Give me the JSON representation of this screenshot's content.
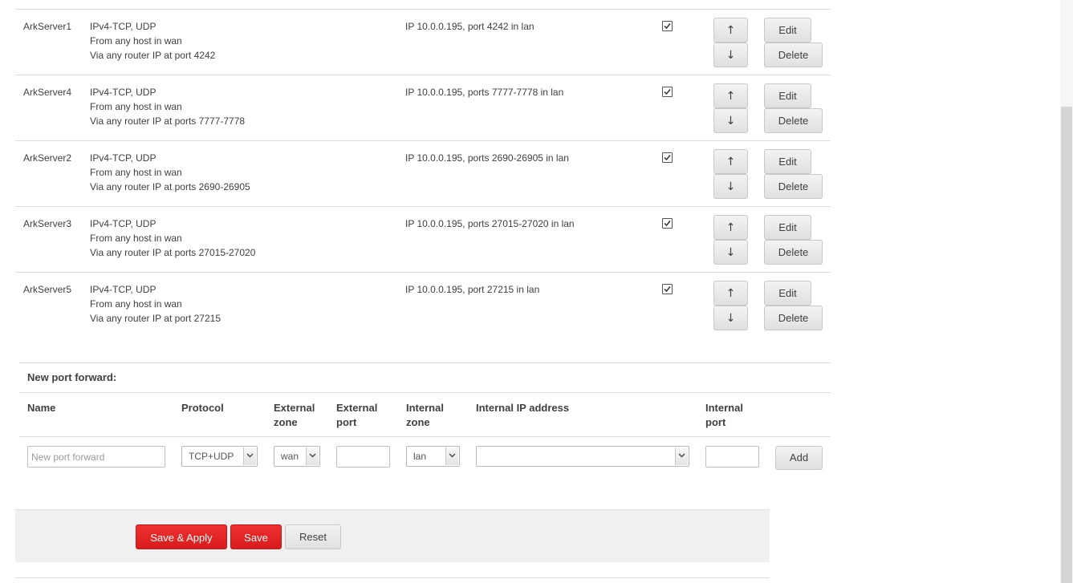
{
  "rules": [
    {
      "name": "ArkServer1",
      "match": [
        "IPv4-TCP, UDP",
        "From any host in wan",
        "Via any router IP at port 4242"
      ],
      "action": "IP 10.0.0.195, port 4242 in lan",
      "enabled": true
    },
    {
      "name": "ArkServer4",
      "match": [
        "IPv4-TCP, UDP",
        "From any host in wan",
        "Via any router IP at ports 7777-7778"
      ],
      "action": "IP 10.0.0.195, ports 7777-7778 in lan",
      "enabled": true
    },
    {
      "name": "ArkServer2",
      "match": [
        "IPv4-TCP, UDP",
        "From any host in wan",
        "Via any router IP at ports 2690-26905"
      ],
      "action": "IP 10.0.0.195, ports 2690-26905 in lan",
      "enabled": true
    },
    {
      "name": "ArkServer3",
      "match": [
        "IPv4-TCP, UDP",
        "From any host in wan",
        "Via any router IP at ports 27015-27020"
      ],
      "action": "IP 10.0.0.195, ports 27015-27020 in lan",
      "enabled": true
    },
    {
      "name": "ArkServer5",
      "match": [
        "IPv4-TCP, UDP",
        "From any host in wan",
        "Via any router IP at port 27215"
      ],
      "action": "IP 10.0.0.195, port 27215 in lan",
      "enabled": true
    }
  ],
  "row_buttons": {
    "up": "↑",
    "down": "↓",
    "edit": "Edit",
    "delete": "Delete"
  },
  "new_forward": {
    "title": "New port forward:",
    "headers": {
      "name": "Name",
      "protocol": "Protocol",
      "external_zone_1": "External",
      "external_zone_2": "zone",
      "external_port_1": "External",
      "external_port_2": "port",
      "internal_zone_1": "Internal",
      "internal_zone_2": "zone",
      "internal_ip": "Internal IP address",
      "internal_port_1": "Internal",
      "internal_port_2": "port"
    },
    "name_placeholder": "New port forward",
    "protocol_value": "TCP+UDP",
    "external_zone_value": "wan",
    "internal_zone_value": "lan",
    "internal_ip_value": "",
    "add_label": "Add"
  },
  "footer": {
    "save_apply": "Save & Apply",
    "save": "Save",
    "reset": "Reset"
  },
  "colors": {
    "accent_red": "#e02424",
    "border": "#dddddd",
    "footer_bg": "#f0f0f0"
  }
}
